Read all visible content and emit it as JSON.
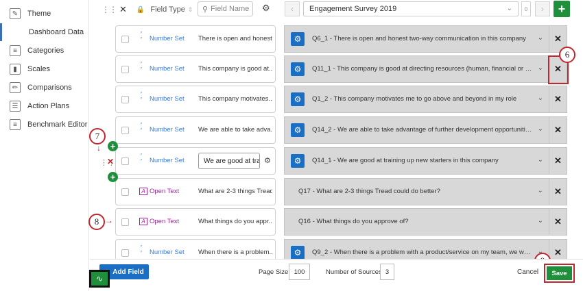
{
  "sidebar": {
    "items": [
      {
        "label": "Theme",
        "icon": "brush-icon",
        "active": false
      },
      {
        "label": "Dashboard Data",
        "icon": "database-icon",
        "active": true
      },
      {
        "label": "Categories",
        "icon": "list-icon",
        "active": false
      },
      {
        "label": "Scales",
        "icon": "bar-chart-icon",
        "active": false
      },
      {
        "label": "Comparisons",
        "icon": "pencil-icon",
        "active": false
      },
      {
        "label": "Action Plans",
        "icon": "clipboard-icon",
        "active": false
      },
      {
        "label": "Benchmark Editor",
        "icon": "list-icon",
        "active": false
      }
    ]
  },
  "header": {
    "field_type_label": "Field Type",
    "field_name_placeholder": "Field Name",
    "survey_name": "Engagement Survey 2019",
    "source_count_hint": "0"
  },
  "rows": [
    {
      "type": "Number Set",
      "field": "There is open and honest...",
      "question": "Q6_1 - There is open and honest two-way communication in this company",
      "gear": true
    },
    {
      "type": "Number Set",
      "field": "This company is good at...",
      "question": "Q11_1 - This company is good at directing resources (human, financial or other) to the...",
      "gear": true
    },
    {
      "type": "Number Set",
      "field": "This company motivates...",
      "question": "Q1_2 - This company motivates me to go above and beyond in my role",
      "gear": true
    },
    {
      "type": "Number Set",
      "field": "We are able to take adva...",
      "question": "Q14_2 - We are able to take advantage of further development opportunities on my t...",
      "gear": true
    },
    {
      "type": "Number Set",
      "field": "We are good at tra",
      "question": "Q14_1 - We are good at training up new starters in this company",
      "gear": true
    },
    {
      "type": "Open Text",
      "field": "What are 2-3 things Tread...",
      "question": "Q17 - What are 2-3 things Tread could do better?",
      "gear": false
    },
    {
      "type": "Open Text",
      "field": "What things do you appr...",
      "question": "Q16 - What things do you approve of?",
      "gear": false
    },
    {
      "type": "Number Set",
      "field": "When there is a problem...",
      "question": "Q9_2 - When there is a problem with a product/service on my team, we work hard u...",
      "gear": true
    }
  ],
  "callouts": {
    "c6": "6",
    "c7": "7",
    "c8": "8",
    "c9": "9"
  },
  "footer": {
    "add_field_label": "Add Field",
    "page_size_label": "Page Size:",
    "page_size_value": "100",
    "num_sources_label": "Number of Sources:",
    "num_sources_value": "3",
    "cancel_label": "Cancel",
    "save_label": "Save"
  },
  "colors": {
    "accent_blue": "#1a6fc4",
    "save_green": "#1e8f3a",
    "callout_red": "#c0262d",
    "number_set": "#2b7de9",
    "open_text": "#a020a0"
  }
}
